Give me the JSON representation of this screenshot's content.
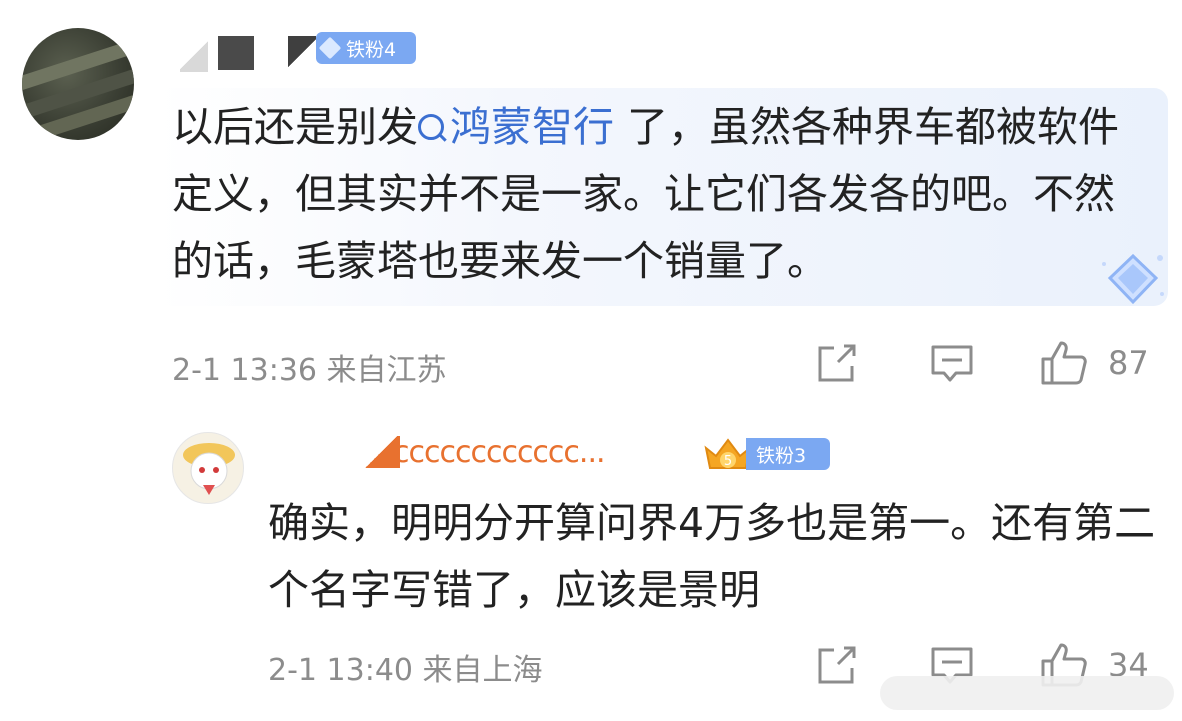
{
  "main_comment": {
    "badge_label": "铁粉4",
    "text_before": "以后还是别发",
    "topic": "鸿蒙智行",
    "text_after": " 了，虽然各种界车都被软件定义，但其实并不是一家。让它们各发各的吧。不然的话，毛蒙塔也要来发一个销量了。",
    "meta": "2-1 13:36 来自江苏",
    "like_count": "87"
  },
  "reply": {
    "username": "cccccccccccccc...",
    "crown_level": "5",
    "badge_label": "铁粉3",
    "text": "确实，明明分开算问界4万多也是第一。还有第二个名字写错了，应该是景明",
    "meta": "2-1 13:40 来自上海",
    "like_count": "34"
  },
  "colors": {
    "link": "#3b6fd1",
    "badge": "#7ba8f2",
    "username_reply": "#e8712f",
    "meta": "#8c8c8c"
  }
}
